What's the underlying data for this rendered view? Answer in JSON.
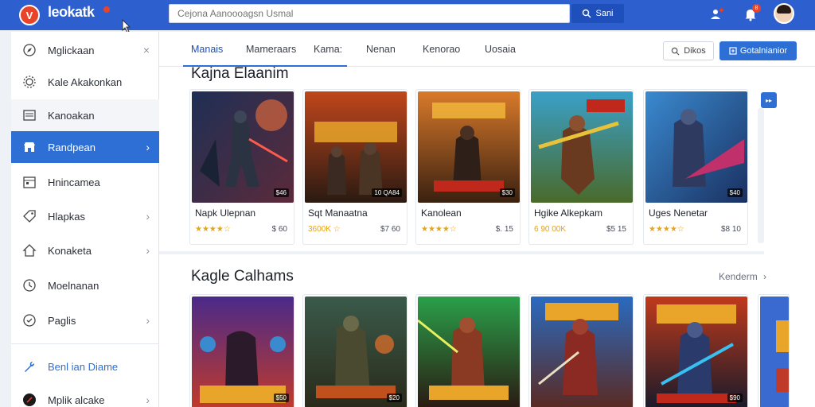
{
  "header": {
    "logo_text": "leokatk",
    "logo_mark": "V",
    "search_placeholder": "Cejona Aanoooagsn Usmal",
    "search_button": "Sani",
    "notif_count": "8"
  },
  "sidebar": {
    "items": [
      {
        "label": "Mglickaan",
        "icon": "compass-icon",
        "trail": "×"
      },
      {
        "label": "Kale Akakonkan",
        "icon": "gear-icon",
        "trail": ""
      },
      {
        "label": "Kanoakan",
        "icon": "list-icon",
        "trail": ""
      },
      {
        "label": "Randpean",
        "icon": "store-icon",
        "trail": "›"
      },
      {
        "label": "Hnincamea",
        "icon": "calendar-icon",
        "trail": ""
      },
      {
        "label": "Hlapkas",
        "icon": "tag-icon",
        "trail": "›"
      },
      {
        "label": "Konaketa",
        "icon": "home-icon",
        "trail": "›"
      },
      {
        "label": "Moelnanan",
        "icon": "clock-icon",
        "trail": ""
      },
      {
        "label": "Paglis",
        "icon": "circle-check-icon",
        "trail": "›"
      },
      {
        "label": "Benl ian Diame",
        "icon": "wrench-icon",
        "trail": ""
      },
      {
        "label": "Mplik alcake",
        "icon": "dark-circle-icon",
        "trail": "›"
      }
    ]
  },
  "tabs": [
    "Manais",
    "Mameraars",
    "Kama:",
    "Nenan",
    "Kenorao",
    "Uosaia"
  ],
  "actions": {
    "filter_label": "Dikos",
    "primary_label": "Gotalnianior"
  },
  "sections": [
    {
      "title": "Kajna Elaanim",
      "see_all": "",
      "cards": [
        {
          "name": "Napk Ulepnan",
          "stars": "★★★★☆",
          "meta": "$ 60",
          "tag": "$46"
        },
        {
          "name": "Sqt Manaatna",
          "stars": "3600K ☆",
          "meta": "$7 60",
          "tag": "10 QA84"
        },
        {
          "name": "Kanolean",
          "stars": "★★★★☆",
          "meta": "$. 15",
          "tag": "$30"
        },
        {
          "name": "Hgike Alkepkam",
          "stars": "6 90 00K",
          "meta": "$5 15",
          "tag": ""
        },
        {
          "name": "Uges Nenetar",
          "stars": "★★★★☆",
          "meta": "$8 10",
          "tag": "$40"
        }
      ]
    },
    {
      "title": "Kagle Calhams",
      "see_all": "Kenderm",
      "cards": [
        {
          "name": "",
          "stars": "",
          "meta": "",
          "tag": "$50"
        },
        {
          "name": "",
          "stars": "",
          "meta": "",
          "tag": "$20"
        },
        {
          "name": "",
          "stars": "",
          "meta": "",
          "tag": ""
        },
        {
          "name": "",
          "stars": "",
          "meta": "",
          "tag": ""
        },
        {
          "name": "",
          "stars": "",
          "meta": "",
          "tag": "$90"
        }
      ]
    }
  ],
  "colors": {
    "topbar": "#2d5fcf",
    "accent": "#2d6fd4",
    "star": "#e6a315",
    "logo": "#e8442a"
  }
}
